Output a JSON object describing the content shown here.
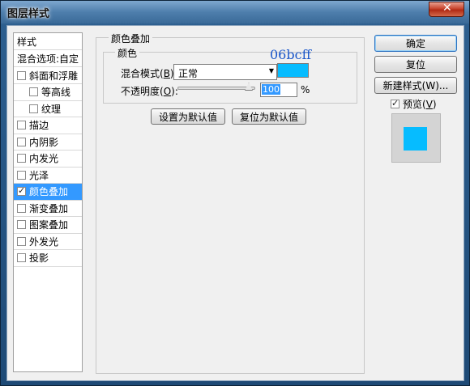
{
  "window": {
    "title": "图层样式",
    "close_glyph": "✕"
  },
  "styles_panel": {
    "header": "样式",
    "blend_options": "混合选项:自定",
    "items": [
      {
        "label": "斜面和浮雕",
        "checked": false,
        "indent": false
      },
      {
        "label": "等高线",
        "checked": false,
        "indent": true
      },
      {
        "label": "纹理",
        "checked": false,
        "indent": true
      },
      {
        "label": "描边",
        "checked": false,
        "indent": false
      },
      {
        "label": "内阴影",
        "checked": false,
        "indent": false
      },
      {
        "label": "内发光",
        "checked": false,
        "indent": false
      },
      {
        "label": "光泽",
        "checked": false,
        "indent": false
      },
      {
        "label": "颜色叠加",
        "checked": true,
        "indent": false,
        "selected": true
      },
      {
        "label": "渐变叠加",
        "checked": false,
        "indent": false
      },
      {
        "label": "图案叠加",
        "checked": false,
        "indent": false
      },
      {
        "label": "外发光",
        "checked": false,
        "indent": false
      },
      {
        "label": "投影",
        "checked": false,
        "indent": false
      }
    ]
  },
  "overlay": {
    "group_title": "颜色叠加",
    "color_group_title": "颜色",
    "blend_mode_label": "混合模式(",
    "blend_mode_key": "B",
    "blend_mode_suffix": "):",
    "blend_mode_value": "正常",
    "opacity_label": "不透明度(",
    "opacity_key": "O",
    "opacity_suffix": "):",
    "opacity_value": "100",
    "opacity_unit": "%",
    "opacity_fraction": 1.0,
    "color_hex": "#06bcff",
    "annotation": "06bcff",
    "set_default_label": "设置为默认值",
    "reset_default_label": "复位为默认值"
  },
  "actions": {
    "ok_label": "确定",
    "reset_label": "复位",
    "new_style_label": "新建样式(W)...",
    "preview_label": "预览(",
    "preview_key": "V",
    "preview_suffix": ")",
    "preview_checked": true
  },
  "colors": {
    "selection": "#3399ff",
    "overlay": "#06bcff"
  }
}
